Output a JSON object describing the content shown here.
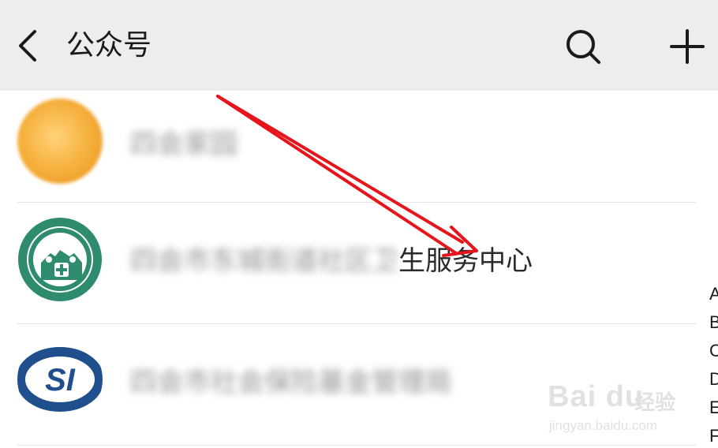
{
  "header": {
    "title": "公众号",
    "back_icon": "chevron-left-icon",
    "search_icon": "search-icon",
    "add_icon": "plus-icon"
  },
  "accounts": [
    {
      "name": "四会家园",
      "blurred": true
    },
    {
      "name_blurred_part": "四会市东城街道社区卫",
      "name_visible_part": "生服务中心",
      "blurred": true
    },
    {
      "name": "四会市社会保险基金管理局",
      "blurred": true
    }
  ],
  "index_bar": [
    "A",
    "B",
    "C",
    "D",
    "E",
    "F"
  ],
  "watermark": {
    "brand": "Bai du",
    "brand_cn": "经验",
    "url": "jingyan.baidu.com"
  },
  "colors": {
    "header_bg": "#ededed",
    "annotation_arrow": "#e8141c",
    "avatar2_green": "#2e8b6e",
    "avatar3_blue": "#1f4f8c"
  }
}
